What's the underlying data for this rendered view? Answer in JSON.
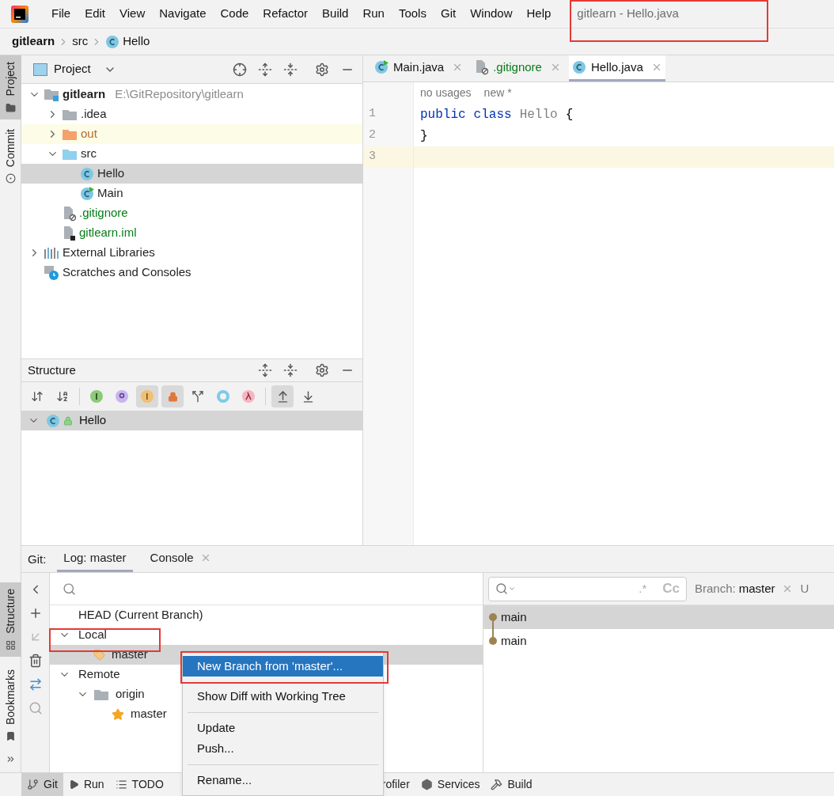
{
  "menu_bar": {
    "items": [
      "File",
      "Edit",
      "View",
      "Navigate",
      "Code",
      "Refactor",
      "Build",
      "Run",
      "Tools",
      "Git",
      "Window",
      "Help"
    ],
    "title": "gitlearn - Hello.java"
  },
  "breadcrumb": [
    {
      "label": "gitlearn",
      "kind": "project"
    },
    {
      "label": "src",
      "kind": "folder"
    },
    {
      "label": "Hello",
      "kind": "class"
    }
  ],
  "left_strip": {
    "top": [
      {
        "label": "Project",
        "kind": "folder",
        "selected": true
      },
      {
        "label": "Commit",
        "kind": "commit",
        "selected": false
      }
    ],
    "bottom": [
      {
        "label": "Structure",
        "kind": "structure",
        "selected": true
      },
      {
        "label": "Bookmarks",
        "kind": "bookmark",
        "selected": false
      }
    ]
  },
  "project_panel": {
    "title": "Project",
    "tree": [
      {
        "label": "gitlearn",
        "path": "E:\\GitRepository\\gitlearn",
        "kind": "module",
        "expanded": true,
        "selected": false,
        "added": false,
        "children": [
          {
            "label": ".idea",
            "kind": "folder",
            "expanded": false,
            "selected": false,
            "added": false
          },
          {
            "label": "out",
            "kind": "excluded",
            "expanded": false,
            "selected": false,
            "added": false
          },
          {
            "label": "src",
            "kind": "source",
            "expanded": true,
            "selected": false,
            "added": false,
            "children": [
              {
                "label": "Hello",
                "kind": "class",
                "selected": true,
                "added": false
              },
              {
                "label": "Main",
                "kind": "main",
                "selected": false,
                "added": false
              }
            ]
          },
          {
            "label": ".gitignore",
            "kind": "gitignore",
            "added": true,
            "selected": false
          },
          {
            "label": "gitlearn.iml",
            "kind": "iml",
            "added": true,
            "selected": false
          }
        ]
      },
      {
        "label": "External Libraries",
        "kind": "libraries",
        "expanded": false,
        "selected": false,
        "added": false
      },
      {
        "label": "Scratches and Consoles",
        "kind": "scratches",
        "selected": false,
        "added": false
      }
    ]
  },
  "structure_panel": {
    "title": "Structure",
    "toolbar": [
      {
        "kind": "sort-visibility",
        "on": false
      },
      {
        "kind": "sort-alpha",
        "on": false
      },
      {
        "kind": "separator"
      },
      {
        "kind": "inherited",
        "on": false
      },
      {
        "kind": "properties",
        "on": false
      },
      {
        "kind": "fields",
        "on": true
      },
      {
        "kind": "non-public",
        "on": true
      },
      {
        "kind": "hierarchy",
        "on": false
      },
      {
        "kind": "anonymous",
        "on": false
      },
      {
        "kind": "lambdas",
        "on": false
      },
      {
        "kind": "separator"
      },
      {
        "kind": "scroll-from",
        "on": true
      },
      {
        "kind": "scroll-to",
        "on": false
      }
    ],
    "tree": [
      {
        "label": "Hello",
        "expanded": true,
        "selected": true
      }
    ]
  },
  "editor": {
    "tabs": [
      {
        "label": "Main.java",
        "kind": "main",
        "selected": false,
        "added": false
      },
      {
        "label": ".gitignore",
        "kind": "gitignore",
        "added": true,
        "selected": false
      },
      {
        "label": "Hello.java",
        "kind": "class",
        "selected": true,
        "added": false
      }
    ],
    "hints": [
      "no usages",
      "new *"
    ],
    "lines": [
      {
        "number": "1",
        "current": false,
        "tokens": [
          {
            "text": "public",
            "kind": "keyword"
          },
          {
            "text": "class",
            "kind": "keyword"
          },
          {
            "text": "Hello",
            "kind": "unused"
          },
          {
            "text": "{",
            "kind": "plain"
          }
        ]
      },
      {
        "number": "2",
        "current": false,
        "tokens": [
          {
            "text": "}",
            "kind": "plain"
          }
        ]
      },
      {
        "number": "3",
        "current": true
      }
    ]
  },
  "git_panel": {
    "label": "Git:",
    "tabs": [
      {
        "label": "Log: master",
        "selected": true,
        "closable": false
      },
      {
        "label": "Console",
        "selected": false,
        "closable": true
      }
    ],
    "branches": [
      {
        "label": "HEAD (Current Branch)",
        "selected": false
      },
      {
        "label": "Local",
        "expanded": true,
        "selected": false,
        "children": [
          {
            "label": "master",
            "kind": "local",
            "selected": true
          }
        ]
      },
      {
        "label": "Remote",
        "expanded": true,
        "selected": false,
        "children": [
          {
            "label": "origin",
            "kind": "remote",
            "expanded": true,
            "selected": false,
            "children": [
              {
                "label": "master",
                "kind": "favorite",
                "selected": false
              }
            ]
          }
        ]
      }
    ],
    "log": {
      "regex_toggle": ".*",
      "case_toggle": "Cc",
      "branch_filter": {
        "label": "Branch:",
        "value": "master"
      },
      "next_filter": "U",
      "commits": [
        {
          "label": "main",
          "selected": true
        },
        {
          "label": "main",
          "selected": false
        }
      ]
    }
  },
  "context_menu": {
    "groups": [
      [
        {
          "label": "New Branch from 'master'...",
          "selected": true
        },
        {
          "label": "Show Diff with Working Tree",
          "selected": false
        }
      ],
      [
        {
          "label": "Update",
          "selected": false
        },
        {
          "label": "Push...",
          "selected": false
        }
      ],
      [
        {
          "label": "Rename...",
          "selected": false
        }
      ]
    ]
  },
  "status_bar": {
    "left_tools": [
      {
        "label": "Git",
        "kind": "git",
        "selected": true
      },
      {
        "label": "Run",
        "kind": "run",
        "selected": false
      },
      {
        "label": "TODO",
        "kind": "todo",
        "selected": false
      }
    ],
    "right_tools": [
      {
        "label": "rofiler",
        "kind": "none",
        "selected": false
      },
      {
        "label": "Services",
        "kind": "services",
        "selected": false
      },
      {
        "label": "Build",
        "kind": "build",
        "selected": false
      }
    ]
  }
}
